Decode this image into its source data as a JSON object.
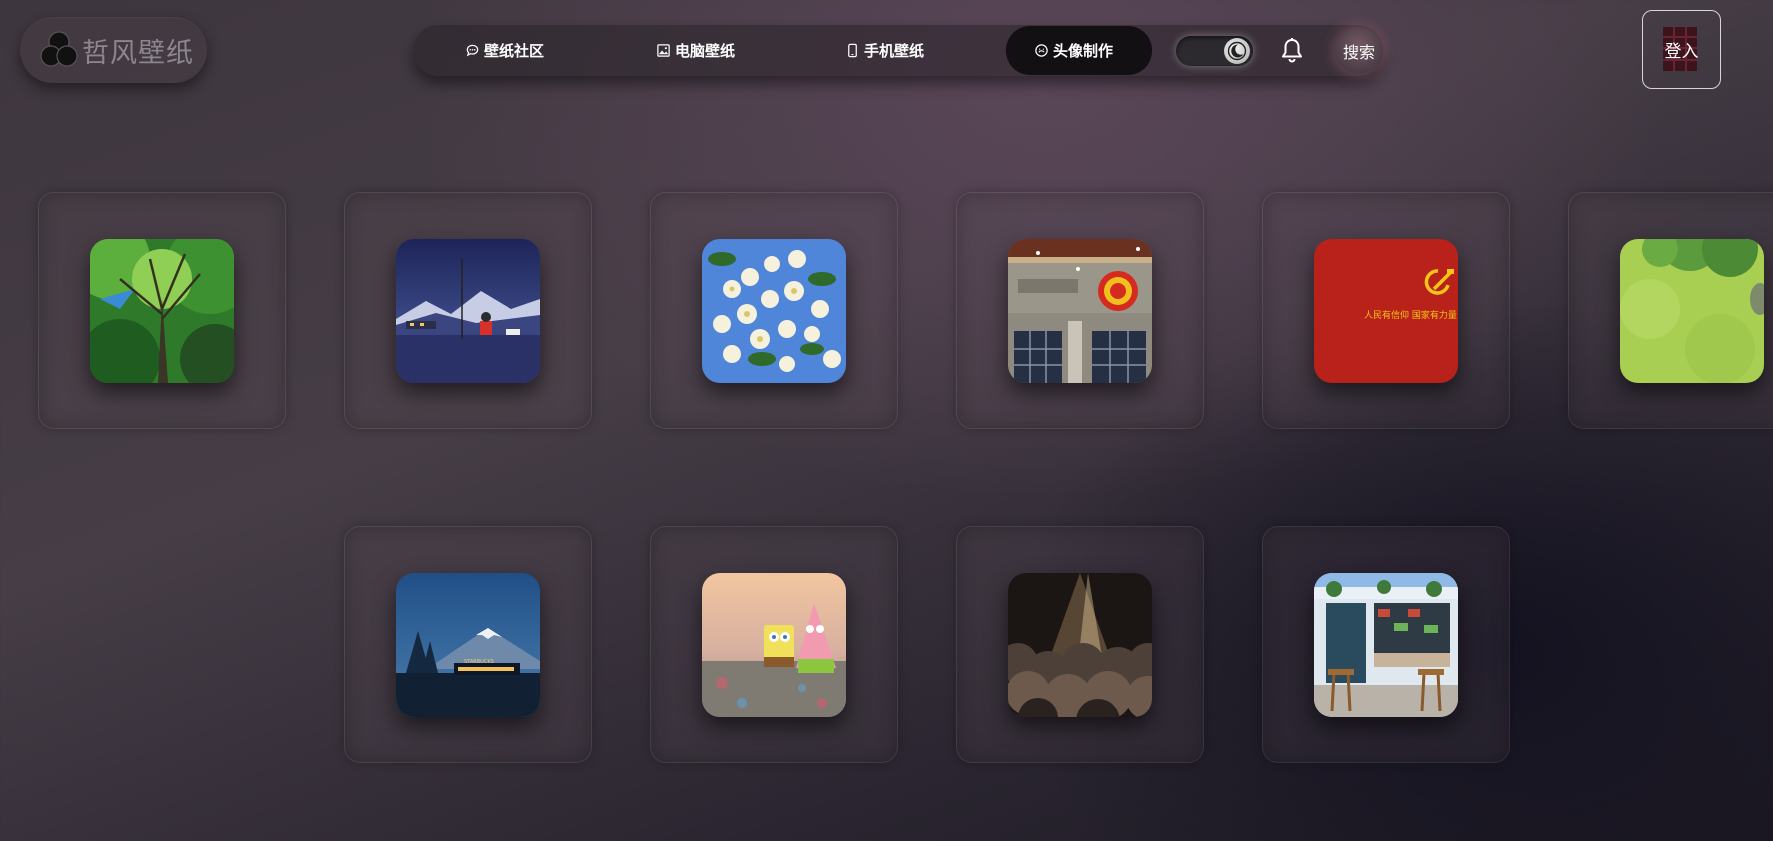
{
  "logo": {
    "text": "哲风壁纸",
    "icon": "three-circles-logo-icon"
  },
  "nav": {
    "items": [
      {
        "label": "壁纸社区",
        "icon": "chat-bubble-icon"
      },
      {
        "label": "电脑壁纸",
        "icon": "image-icon"
      },
      {
        "label": "手机壁纸",
        "icon": "phone-icon"
      },
      {
        "label": "头像制作",
        "icon": "smiley-icon",
        "active": true
      }
    ],
    "theme_toggle_icon": "moon-icon",
    "bell_icon": "bell-icon",
    "search_label": "搜索"
  },
  "login": {
    "label": "登入"
  },
  "gallery": {
    "row1": [
      {
        "subject": "forest canopy"
      },
      {
        "subject": "night snow mountain scene"
      },
      {
        "subject": "white blossoms"
      },
      {
        "subject": "national emblem building"
      },
      {
        "subject": "red banner",
        "caption": "人民有信仰  国家有力量"
      },
      {
        "subject": "green cartoon meadow"
      }
    ],
    "row2": [
      {
        "subject": "mount fuji at dusk",
        "caption": "STARBUCKS"
      },
      {
        "subject": "spongebob and patrick"
      },
      {
        "subject": "sunlight over clouds"
      },
      {
        "subject": "street cafe storefront"
      }
    ]
  },
  "colors": {
    "accent_active": "#121012",
    "flag_red": "#b8221a",
    "gold": "#f5c518"
  }
}
